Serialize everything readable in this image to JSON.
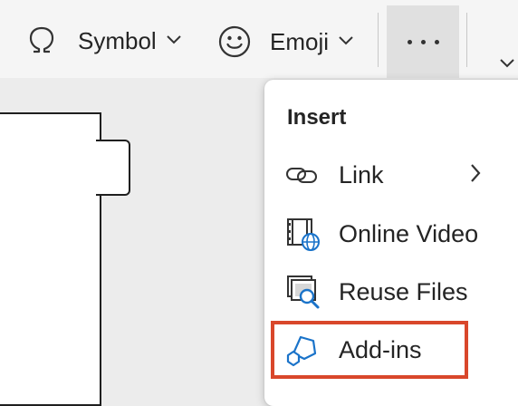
{
  "ribbon": {
    "symbol_label": "Symbol",
    "emoji_label": "Emoji",
    "symbol_icon": "omega-icon",
    "emoji_icon": "smiley-icon",
    "more_icon": "more-horizontal-icon"
  },
  "menu": {
    "heading": "Insert",
    "items": [
      {
        "label": "Link",
        "icon": "link-icon",
        "has_submenu": true
      },
      {
        "label": "Online Video",
        "icon": "online-video-icon",
        "has_submenu": false
      },
      {
        "label": "Reuse Files",
        "icon": "reuse-files-icon",
        "has_submenu": false
      },
      {
        "label": "Add-ins",
        "icon": "add-ins-icon",
        "has_submenu": false,
        "highlighted": true
      }
    ]
  },
  "colors": {
    "highlight": "#d9472b",
    "accent_blue": "#1a73c9"
  }
}
